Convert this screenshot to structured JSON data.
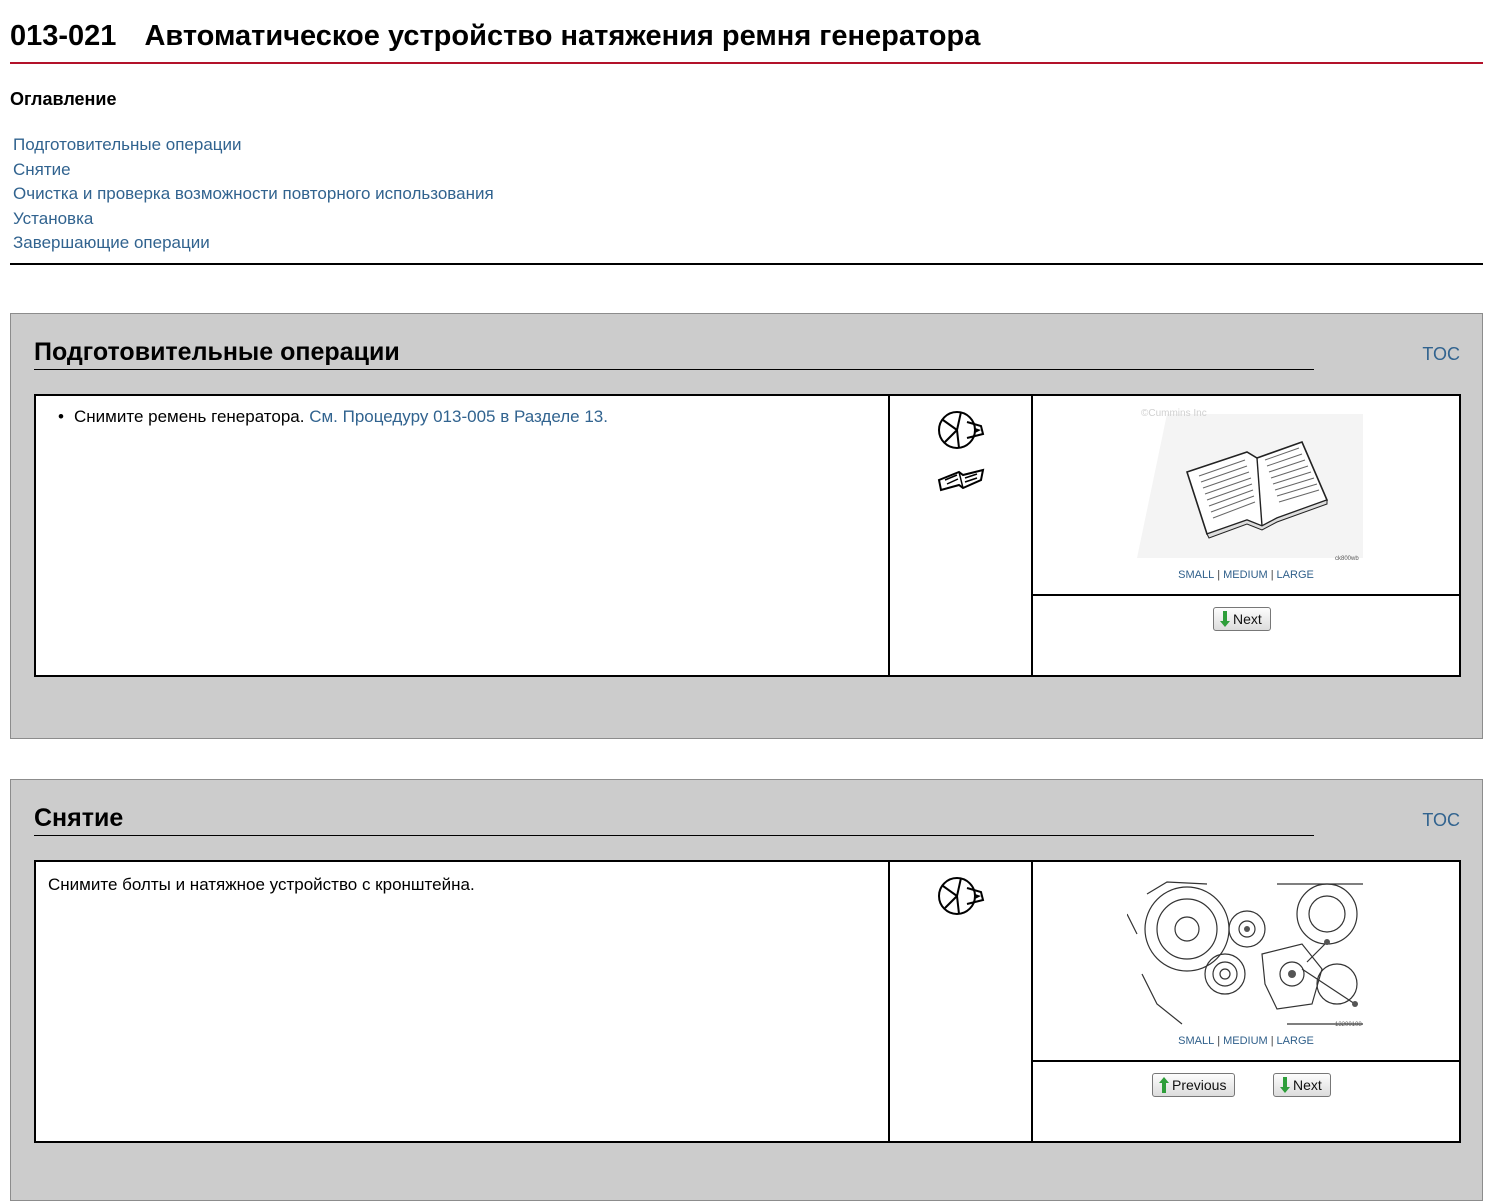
{
  "header": {
    "code": "013-021",
    "title": "Автоматическое устройство натяжения ремня генератора"
  },
  "toc": {
    "heading": "Оглавление",
    "items": [
      "Подготовительные операции",
      "Снятие",
      "Очистка и проверка возможности повторного использования",
      "Установка",
      "Завершающие операции"
    ]
  },
  "sections": [
    {
      "title": "Подготовительные операции",
      "toc_link": "TOC",
      "step_text": "Снимите ремень генератора.",
      "step_link": "См. Процедуру 013-005 в Разделе 13.",
      "icons": [
        "wrench-icon",
        "book-icon"
      ],
      "figure": {
        "watermark": "©Cummins Inc",
        "number": "ck800wb"
      },
      "sizes": [
        "SMALL",
        "MEDIUM",
        "LARGE"
      ],
      "next_label": "Next"
    },
    {
      "title": "Снятие",
      "toc_link": "TOC",
      "step_text": "Снимите болты и натяжное устройство с кронштейна.",
      "icons": [
        "wrench-icon"
      ],
      "figure": {
        "number": "13200108"
      },
      "sizes": [
        "SMALL",
        "MEDIUM",
        "LARGE"
      ],
      "previous_label": "Previous",
      "next_label": "Next"
    }
  ],
  "colors": {
    "title_rule": "#b3122a",
    "link": "#31638f",
    "section_bg": "#cccccc",
    "arrow_green": "#2e9e3a"
  }
}
